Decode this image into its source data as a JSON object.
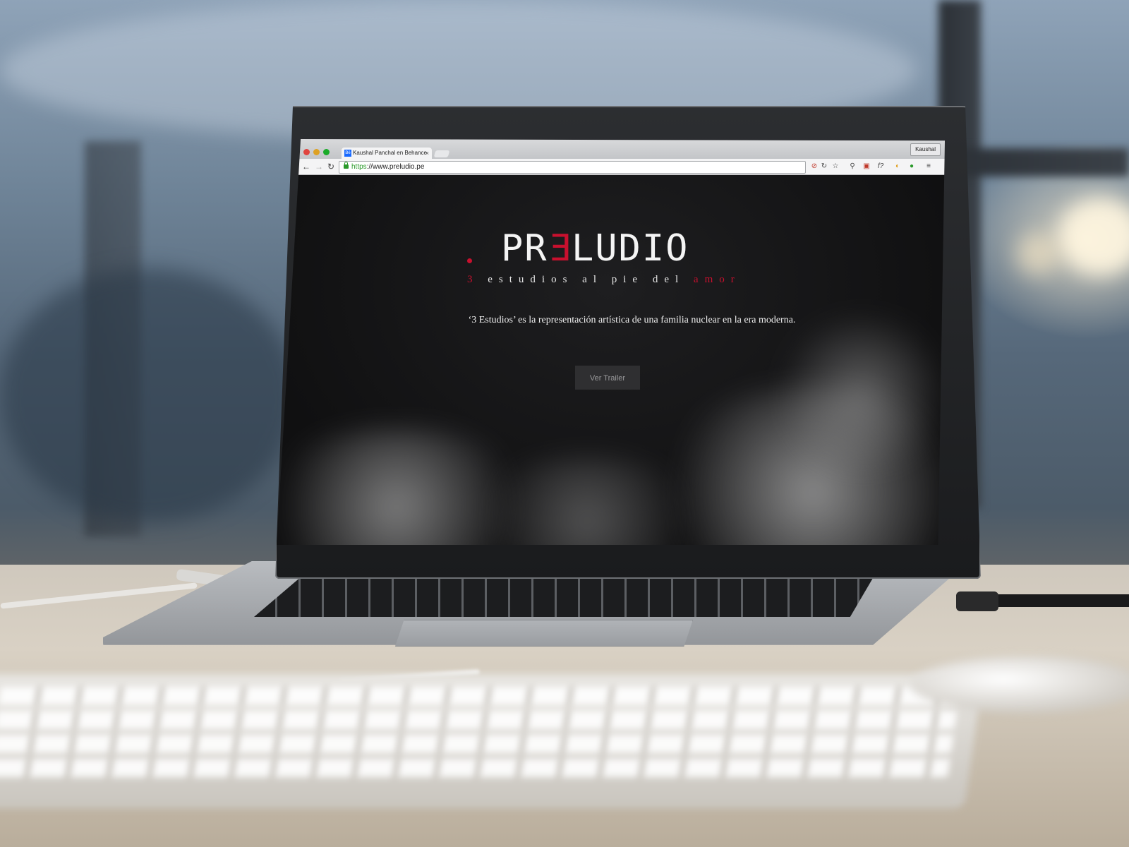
{
  "browser": {
    "tab_favicon": "Bē",
    "tab_title": "Kaushal Panchal en Behance",
    "tab_close": "×",
    "profile_name": "Kaushal",
    "url_scheme": "https",
    "url_rest": "://www.preludio.pe",
    "nav": {
      "back": "←",
      "forward": "→",
      "reload": "↻"
    },
    "extension_icons": [
      "⊘",
      "↻",
      "☆",
      "⚲",
      "▣",
      "f?",
      "◐",
      "●",
      "≡"
    ]
  },
  "page": {
    "brand_prefix": "PR",
    "brand_mirrored_letter": "E",
    "brand_suffix": "LUDIO",
    "tagline_number": "3",
    "tagline_middle": "estudios al pie del",
    "tagline_end": "amor",
    "description": "‘3 Estudios’ es la representación artística de una familia nuclear en la era moderna.",
    "trailer_button": "Ver Trailer"
  },
  "colors": {
    "accent_red": "#c8102e",
    "page_background": "#111111",
    "button_background": "#2f2f31"
  }
}
